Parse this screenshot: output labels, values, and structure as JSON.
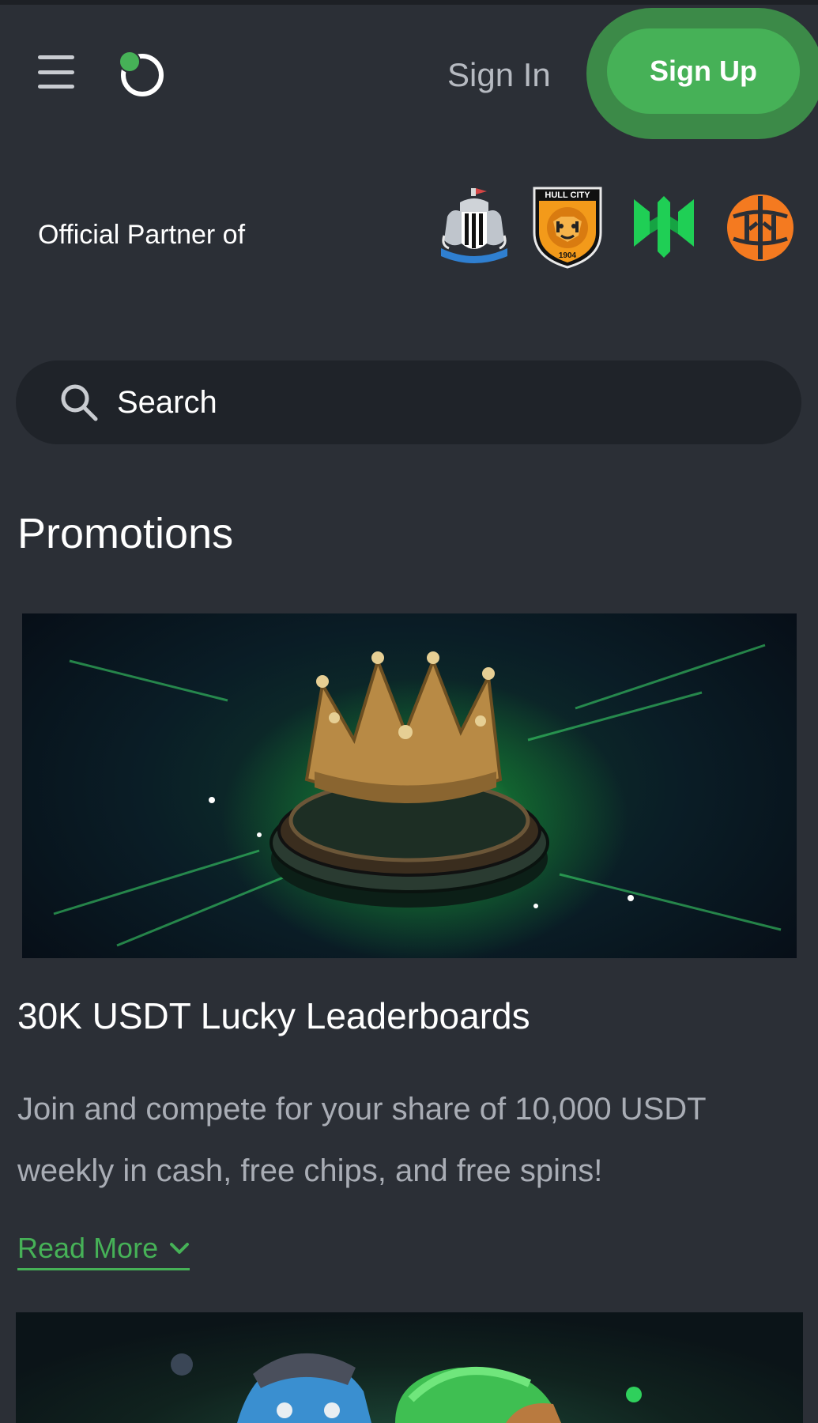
{
  "header": {
    "menu_icon": "hamburger-menu-icon",
    "logo_icon": "brand-ring-logo",
    "signin_label": "Sign In",
    "signup_label": "Sign Up",
    "accent_color": "#46b157"
  },
  "partners": {
    "label": "Official Partner of",
    "badges": [
      {
        "name": "newcastle-united-crest"
      },
      {
        "name": "hull-city-crest"
      },
      {
        "name": "green-esports-logo"
      },
      {
        "name": "orange-basketball-logo"
      }
    ],
    "hull_city_text": "HULL CITY",
    "hull_city_year": "1904"
  },
  "search": {
    "placeholder": "Search",
    "icon": "search-icon"
  },
  "promotions": {
    "title": "Promotions",
    "items": [
      {
        "image": "golden-crown-on-poker-chips",
        "title": "30K USDT Lucky Leaderboards",
        "description": "Join and compete for your share of 10,000 USDT weekly in cash, free chips, and free spins!",
        "read_more": "Read More"
      },
      {
        "image": "cartoon-characters-banner"
      }
    ]
  }
}
